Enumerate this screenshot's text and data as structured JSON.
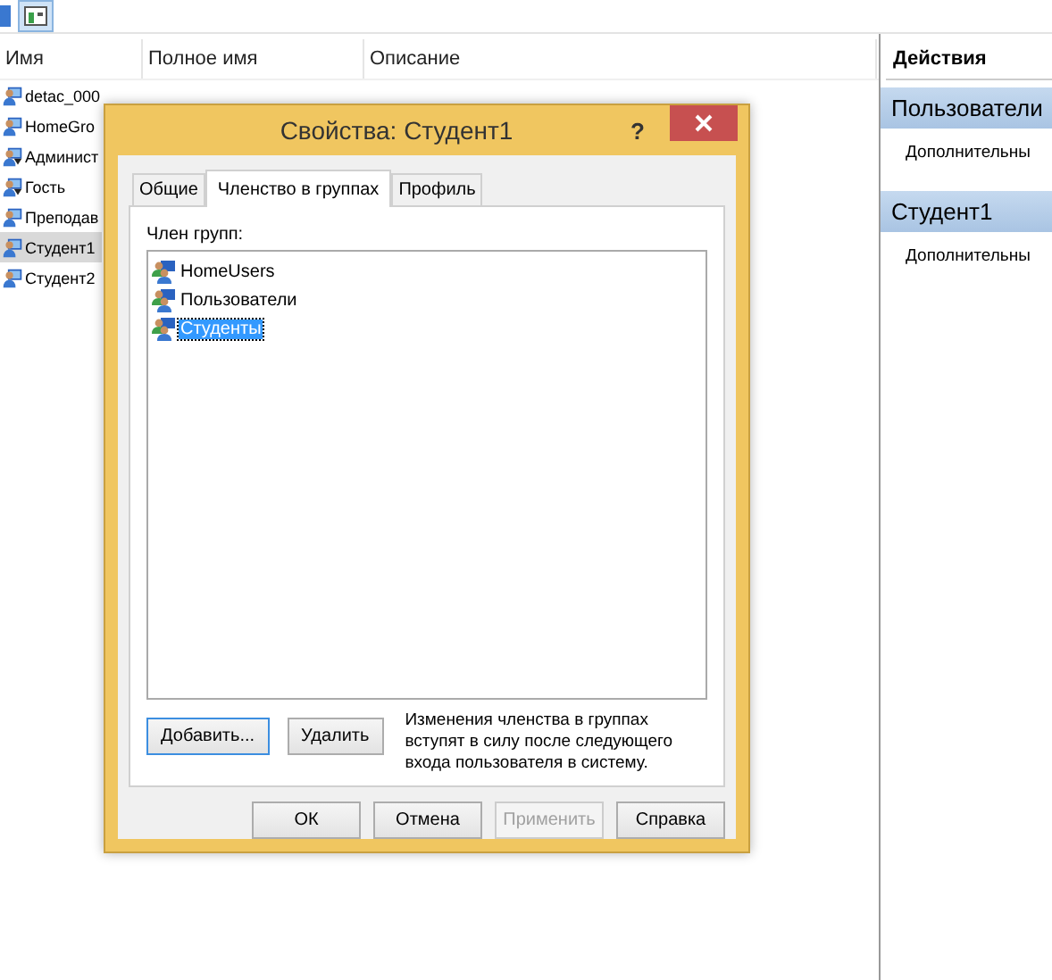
{
  "list": {
    "columns": [
      "Имя",
      "Полное имя",
      "Описание"
    ],
    "rows": [
      {
        "name": "detac_000",
        "disabled": false,
        "selected": false
      },
      {
        "name": "HomeGro",
        "disabled": false,
        "selected": false
      },
      {
        "name": "Админист",
        "disabled": true,
        "selected": false
      },
      {
        "name": "Гость",
        "disabled": true,
        "selected": false
      },
      {
        "name": "Преподав",
        "disabled": false,
        "selected": false
      },
      {
        "name": "Студент1",
        "disabled": false,
        "selected": true
      },
      {
        "name": "Студент2",
        "disabled": false,
        "selected": false
      }
    ]
  },
  "actions": {
    "title": "Действия",
    "sections": [
      {
        "title": "Пользователи",
        "items": [
          "Дополнительны"
        ]
      },
      {
        "title": "Студент1",
        "items": [
          "Дополнительны"
        ]
      }
    ]
  },
  "dialog": {
    "title": "Свойства: Студент1",
    "help": "?",
    "tabs": [
      {
        "label": "Общие",
        "selected": false
      },
      {
        "label": "Членство в группах",
        "selected": true
      },
      {
        "label": "Профиль",
        "selected": false
      }
    ],
    "groups_label": "Член групп:",
    "groups": [
      {
        "name": "HomeUsers",
        "selected": false
      },
      {
        "name": "Пользователи",
        "selected": false
      },
      {
        "name": "Студенты",
        "selected": true
      }
    ],
    "panel_buttons": [
      {
        "label": "Добавить...",
        "focused": true
      },
      {
        "label": "Удалить",
        "focused": false
      }
    ],
    "note": "Изменения членства в группах вступят в силу после следующего входа пользователя в систему.",
    "buttons": [
      {
        "label": "ОК",
        "disabled": false
      },
      {
        "label": "Отмена",
        "disabled": false
      },
      {
        "label": "Применить",
        "disabled": true
      },
      {
        "label": "Справка",
        "disabled": false
      }
    ]
  }
}
